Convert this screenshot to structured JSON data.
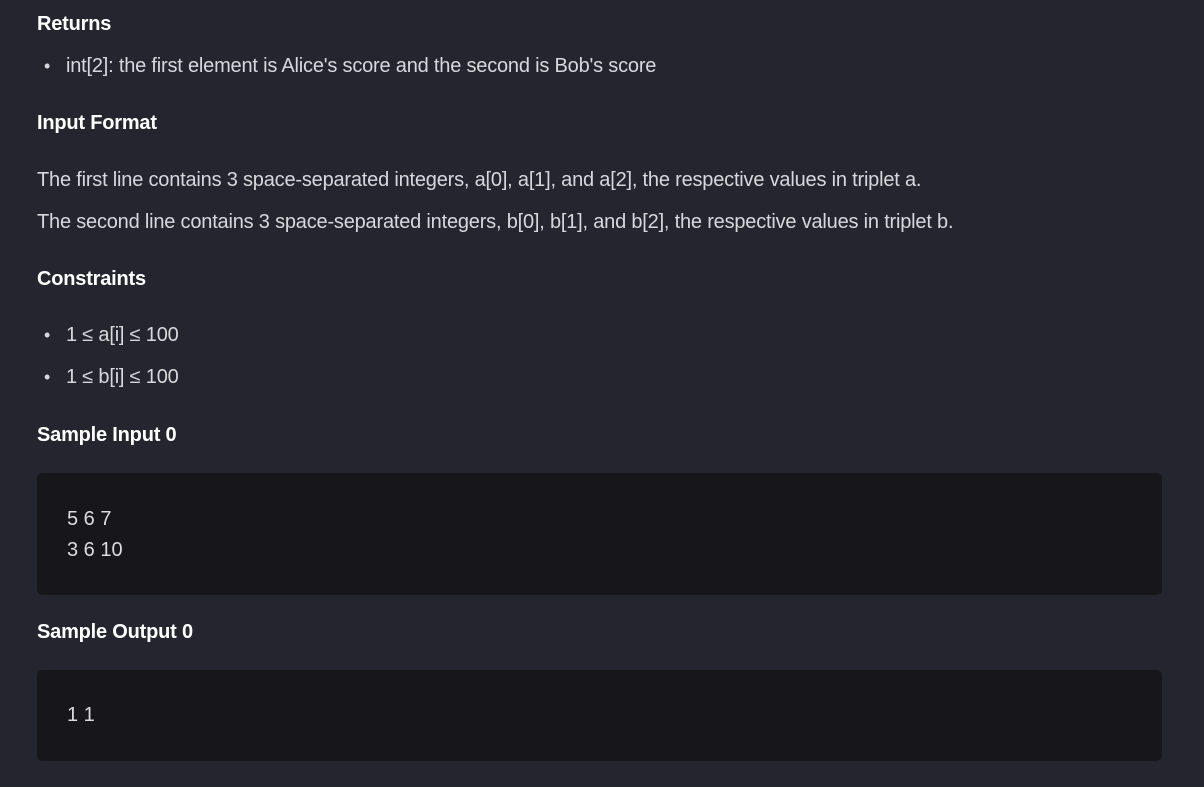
{
  "returns": {
    "heading": "Returns",
    "items": [
      "int[2]: the first element is Alice's score and the second is Bob's score"
    ]
  },
  "input_format": {
    "heading": "Input Format",
    "lines": [
      "The first line contains 3 space-separated integers, a[0], a[1], and a[2], the respective values in triplet a.",
      "The second line contains 3 space-separated integers, b[0], b[1], and b[2], the respective values in triplet b."
    ]
  },
  "constraints": {
    "heading": "Constraints",
    "items": [
      "1 ≤ a[i] ≤ 100",
      "1 ≤ b[i] ≤ 100"
    ]
  },
  "sample_input": {
    "heading": "Sample Input 0",
    "lines": [
      "5 6 7",
      "3 6 10"
    ]
  },
  "sample_output": {
    "heading": "Sample Output 0",
    "lines": [
      "1 1"
    ]
  },
  "icons": {
    "bullet": "bullet-dot-icon"
  }
}
